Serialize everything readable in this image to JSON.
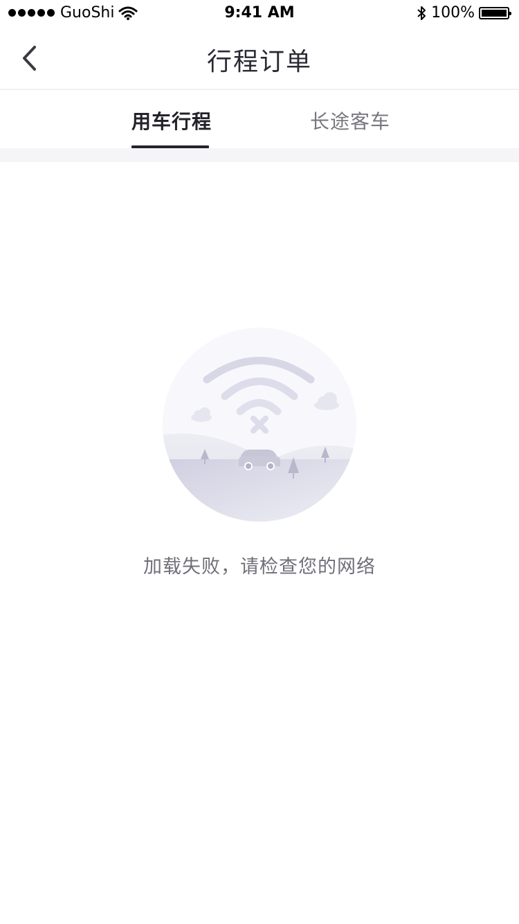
{
  "status_bar": {
    "carrier": "GuoShi",
    "time": "9:41 AM",
    "battery": "100%",
    "signal_icon": "signal-dots-icon",
    "wifi_icon": "wifi-icon",
    "bluetooth_icon": "bluetooth-icon",
    "battery_icon": "battery-full-icon"
  },
  "nav": {
    "title": "行程订单",
    "back_icon": "chevron-left-icon"
  },
  "tabs": [
    {
      "label": "用车行程",
      "active": true
    },
    {
      "label": "长途客车",
      "active": false
    }
  ],
  "empty_state": {
    "illustration_icon": "wifi-disconnected-illustration-icon",
    "message": "加载失败，请检查您的网络"
  },
  "colors": {
    "accent": "#24242b",
    "inactive_tab": "#77777f",
    "message": "#6f6f78",
    "band": "#f5f5f8"
  }
}
